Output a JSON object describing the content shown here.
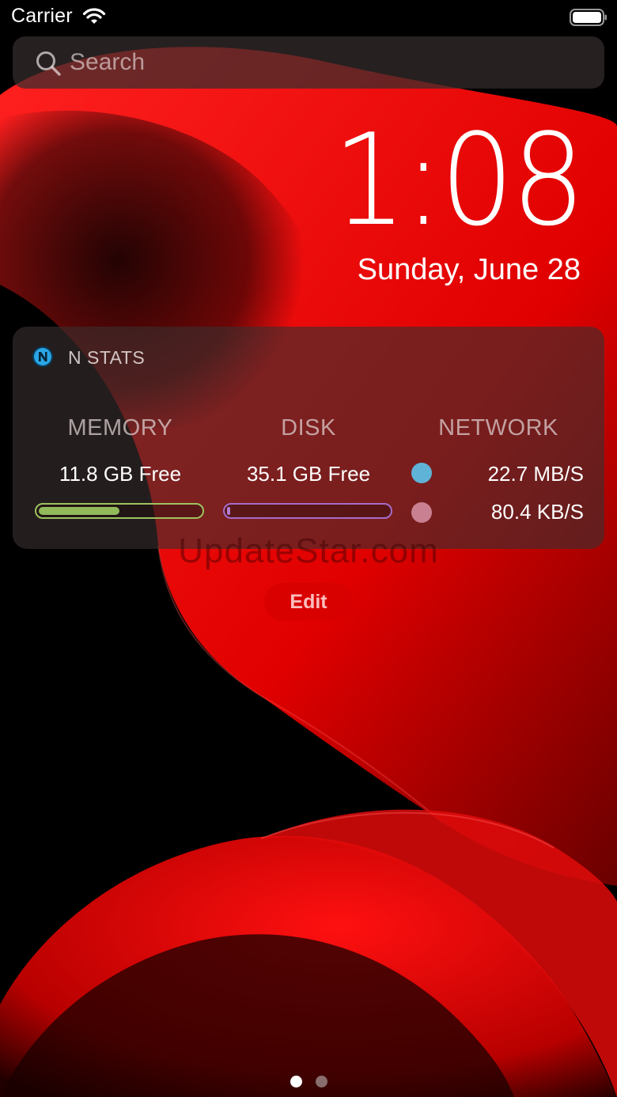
{
  "status_bar": {
    "carrier": "Carrier",
    "wifi_icon": "wifi-icon",
    "battery_icon": "battery-icon"
  },
  "search": {
    "placeholder": "Search",
    "icon": "search-icon"
  },
  "lock": {
    "time": "1:08",
    "date": "Sunday, June 28"
  },
  "widget": {
    "title": "N STATS",
    "logo_icon": "nstats-logo-icon",
    "memory": {
      "header": "MEMORY",
      "free": "11.8 GB Free",
      "bar_fill_fraction": 0.5,
      "color": "#92ba5b"
    },
    "disk": {
      "header": "DISK",
      "free": "35.1 GB Free",
      "bar_fill_fraction": 0.02,
      "color": "#b27bd2"
    },
    "network": {
      "header": "NETWORK",
      "download": "22.7 MB/S",
      "upload": "80.4 KB/S",
      "download_color": "#5fb3d6",
      "upload_color": "#c98090"
    }
  },
  "watermark": "UpdateStar.com",
  "edit_label": "Edit",
  "page_dots": {
    "count": 2,
    "active": 1
  }
}
